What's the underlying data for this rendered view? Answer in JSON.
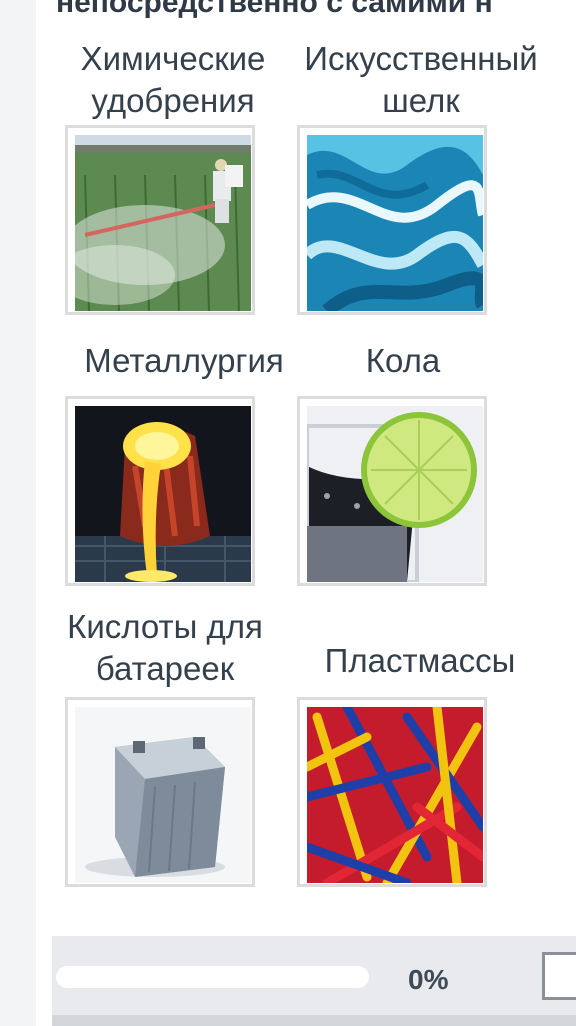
{
  "header": {
    "partial_text": "непосредственно с самими н"
  },
  "items": [
    {
      "label": "Химические удобрения",
      "image": "crop-spraying-photo"
    },
    {
      "label": "Искусственный шелк",
      "image": "blue-silk-photo"
    },
    {
      "label": "Металлургия",
      "image": "molten-metal-photo"
    },
    {
      "label": "Кола",
      "image": "cola-lime-photo"
    },
    {
      "label": "Кислоты для батареек",
      "image": "car-battery-photo"
    },
    {
      "label": "Пластмассы",
      "image": "plastic-forks-photo"
    }
  ],
  "progress": {
    "percent_label": "0%",
    "value": 0
  },
  "colors": {
    "accent": "#2f86c9",
    "text": "#34404c"
  }
}
